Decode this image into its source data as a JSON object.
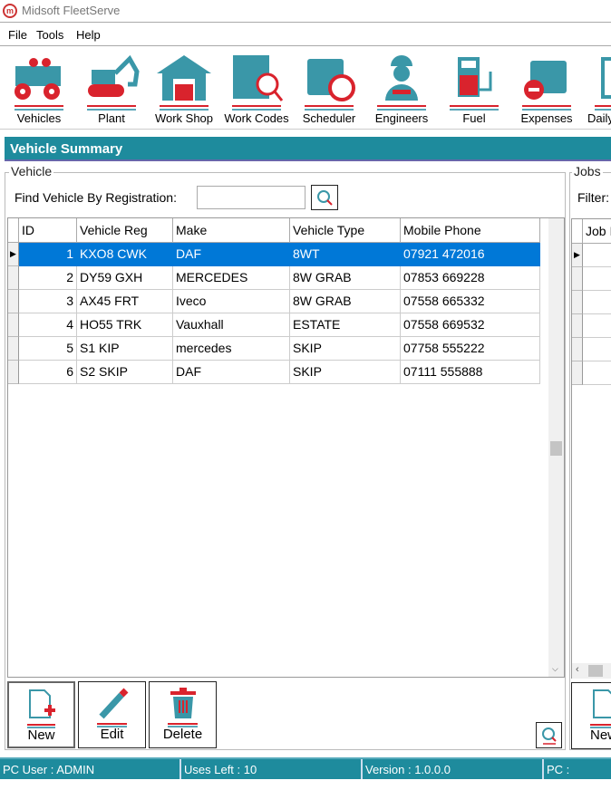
{
  "window": {
    "title": "Midsoft FleetServe",
    "logo": "m"
  },
  "menu": [
    "File",
    "Tools",
    "Help"
  ],
  "toolbar": [
    {
      "label": "Vehicles",
      "icon": "dump-truck-icon"
    },
    {
      "label": "Plant",
      "icon": "excavator-icon"
    },
    {
      "label": "Work Shop",
      "icon": "garage-icon"
    },
    {
      "label": "Work Codes",
      "icon": "code-search-icon"
    },
    {
      "label": "Scheduler",
      "icon": "calendar-clock-icon"
    },
    {
      "label": "Engineers",
      "icon": "engineer-icon"
    },
    {
      "label": "Fuel",
      "icon": "fuel-pump-icon"
    },
    {
      "label": "Expenses",
      "icon": "wallet-icon"
    },
    {
      "label": "Daily",
      "icon": "list-icon"
    }
  ],
  "section_title": "Vehicle Summary",
  "vehicle": {
    "group_label": "Vehicle",
    "find_label": "Find Vehicle By Registration:",
    "find_value": "",
    "columns": [
      "ID",
      "Vehicle Reg",
      "Make",
      "Vehicle Type",
      "Mobile Phone"
    ],
    "rows": [
      [
        "1",
        "KXO8 CWK",
        "DAF",
        "8WT",
        "07921 472016"
      ],
      [
        "2",
        "DY59 GXH",
        "MERCEDES",
        "8W GRAB",
        "07853 669228"
      ],
      [
        "3",
        "AX45 FRT",
        "Iveco",
        "8W GRAB",
        "07558 665332"
      ],
      [
        "4",
        "HO55 TRK",
        "Vauxhall",
        "ESTATE",
        "07558 669532"
      ],
      [
        "5",
        "S1 KIP",
        "mercedes",
        "SKIP",
        "07758 555222"
      ],
      [
        "6",
        "S2 SKIP",
        "DAF",
        "SKIP",
        "07111 555888"
      ]
    ],
    "selected_row": 0,
    "buttons": {
      "new": "New",
      "edit": "Edit",
      "delete": "Delete"
    }
  },
  "jobs": {
    "group_label": "Jobs",
    "filter_label": "Filter:",
    "columns": [
      "Job I"
    ],
    "new_button": "New"
  },
  "status": {
    "user": "PC User : ADMIN",
    "uses": "Uses Left : 10",
    "version": "Version : 1.0.0.0",
    "pc": "PC : DESKTOP"
  },
  "colors": {
    "teal": "#1e8b9d",
    "red": "#d9232d",
    "selection": "#0078d7"
  }
}
